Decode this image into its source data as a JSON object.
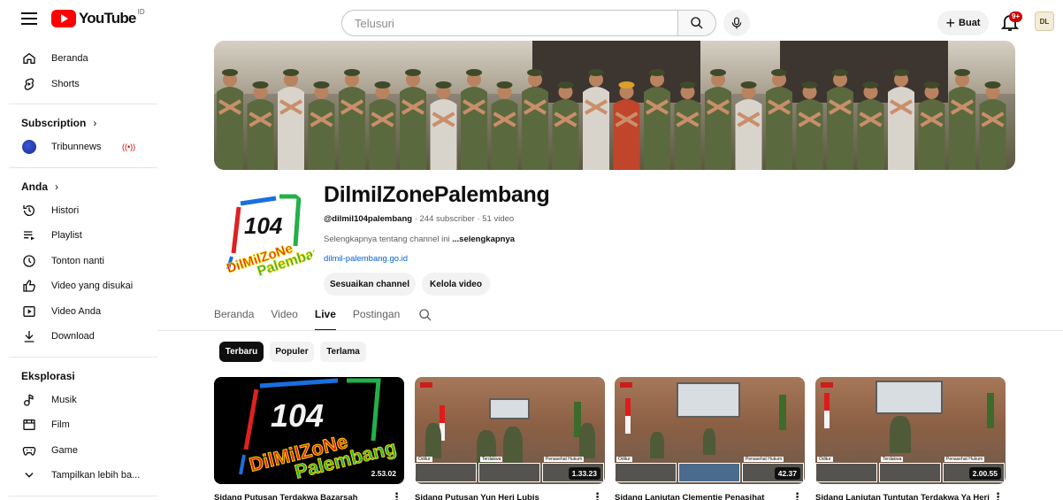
{
  "header": {
    "logo_text": "YouTube",
    "country_code": "ID",
    "search_placeholder": "Telusuri",
    "create_label": "Buat",
    "notification_count": "9+",
    "avatar_text": "DL"
  },
  "sidebar": {
    "main": [
      {
        "label": "Beranda",
        "icon": "home-icon"
      },
      {
        "label": "Shorts",
        "icon": "shorts-icon"
      }
    ],
    "subscription_heading": "Subscription",
    "subscriptions": [
      {
        "label": "Tribunnews",
        "live": "((•))"
      }
    ],
    "you_heading": "Anda",
    "you_items": [
      {
        "label": "Histori",
        "icon": "history-icon"
      },
      {
        "label": "Playlist",
        "icon": "playlist-icon"
      },
      {
        "label": "Tonton nanti",
        "icon": "clock-icon"
      },
      {
        "label": "Video yang disukai",
        "icon": "thumb-up-icon"
      },
      {
        "label": "Video Anda",
        "icon": "play-square-icon"
      },
      {
        "label": "Download",
        "icon": "download-icon"
      }
    ],
    "explore_heading": "Eksplorasi",
    "explore_items": [
      {
        "label": "Musik",
        "icon": "music-icon"
      },
      {
        "label": "Film",
        "icon": "film-icon"
      },
      {
        "label": "Game",
        "icon": "game-icon"
      },
      {
        "label": "Tampilkan lebih ba...",
        "icon": "chevron-down-icon"
      }
    ]
  },
  "channel": {
    "name": "DilmilZonePalembang",
    "handle": "@dilmil104palembang",
    "stats": " · 244 subscriber · 51 video",
    "description": "Selengkapnya tentang channel ini ",
    "more": "...selengkapnya",
    "link": "dilmil-palembang.go.id",
    "logo_number": "104",
    "logo_text": "DilMilZoNe",
    "logo_text2": "Palembang",
    "customize_label": "Sesuaikan channel",
    "manage_label": "Kelola video"
  },
  "tabs": [
    {
      "label": "Beranda",
      "active": false
    },
    {
      "label": "Video",
      "active": false
    },
    {
      "label": "Live",
      "active": true
    },
    {
      "label": "Postingan",
      "active": false
    }
  ],
  "chips": [
    {
      "label": "Terbaru",
      "active": true
    },
    {
      "label": "Populer",
      "active": false
    },
    {
      "label": "Terlama",
      "active": false
    }
  ],
  "videos": [
    {
      "title": "Sidang Putusan Terdakwa Bazarsah",
      "duration": "2.53.02"
    },
    {
      "title": "Sidang Putusan Yun Heri Lubis",
      "duration": "1.33.23"
    },
    {
      "title": "Sidang Lanjutan Clementie Penasihat",
      "duration": "42.37"
    },
    {
      "title": "Sidang Lanjutan Tuntutan Terdakwa Ya Heri",
      "duration": "2.00.55"
    }
  ],
  "thumb_labels": {
    "oditur": "Oditur",
    "terdakwa": "Terdakwa",
    "penasehat": "Penasehat Hukum"
  }
}
